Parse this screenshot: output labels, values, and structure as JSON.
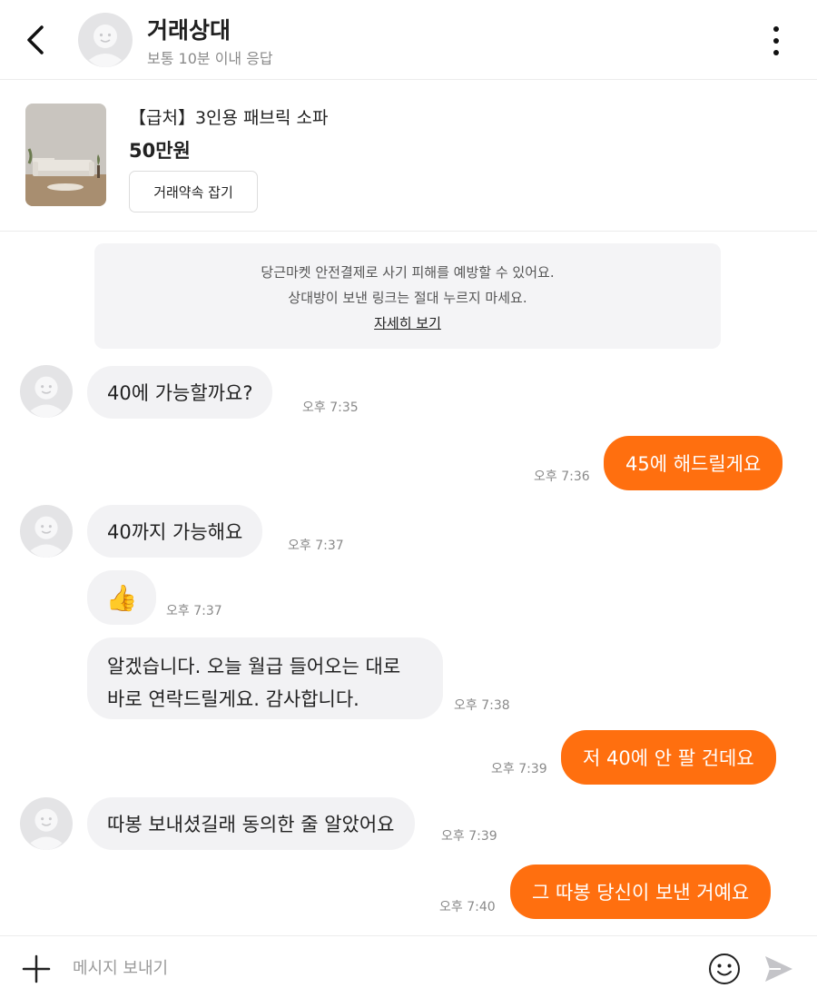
{
  "header": {
    "name": "거래상대",
    "subtitle": "보통 10분 이내 응답",
    "back_icon": "chevron-left-icon",
    "more_icon": "more-vertical-icon"
  },
  "product": {
    "title": "【급처】3인용 패브릭 소파",
    "price": "50만원",
    "deal_button": "거래약속 잡기"
  },
  "notice": {
    "line1": "당근마켓 안전결제로 사기 피해를 예방할 수 있어요.",
    "line2": "상대방이 보낸 링크는 절대 누르지 마세요.",
    "link": "자세히 보기"
  },
  "messages": [
    {
      "from": "other",
      "text": "40에 가능할까요?",
      "time": "오후 7:35"
    },
    {
      "from": "me",
      "text": "45에 해드릴게요",
      "time": "오후 7:36"
    },
    {
      "from": "other",
      "text": "40까지 가능해요",
      "time": "오후 7:37"
    },
    {
      "from": "other",
      "text": "👍",
      "time": "오후 7:37"
    },
    {
      "from": "other",
      "text_lines": [
        "알겠습니다. 오늘 월급 들어오는 대로",
        "바로 연락드릴게요. 감사합니다."
      ],
      "time": "오후 7:38"
    },
    {
      "from": "me",
      "text": "저 40에 안 팔 건데요",
      "time": "오후 7:39"
    },
    {
      "from": "other",
      "text": "따봉 보내셨길래 동의한 줄 알았어요",
      "time": "오후 7:39"
    },
    {
      "from": "me",
      "text": "그 따봉 당신이 보낸 거예요",
      "time": "오후 7:40"
    }
  ],
  "input": {
    "placeholder": "메시지 보내기",
    "value": ""
  },
  "colors": {
    "accent": "#ff6f0f",
    "incoming_bubble": "#f2f2f4",
    "notice_bg": "#f4f4f6"
  }
}
